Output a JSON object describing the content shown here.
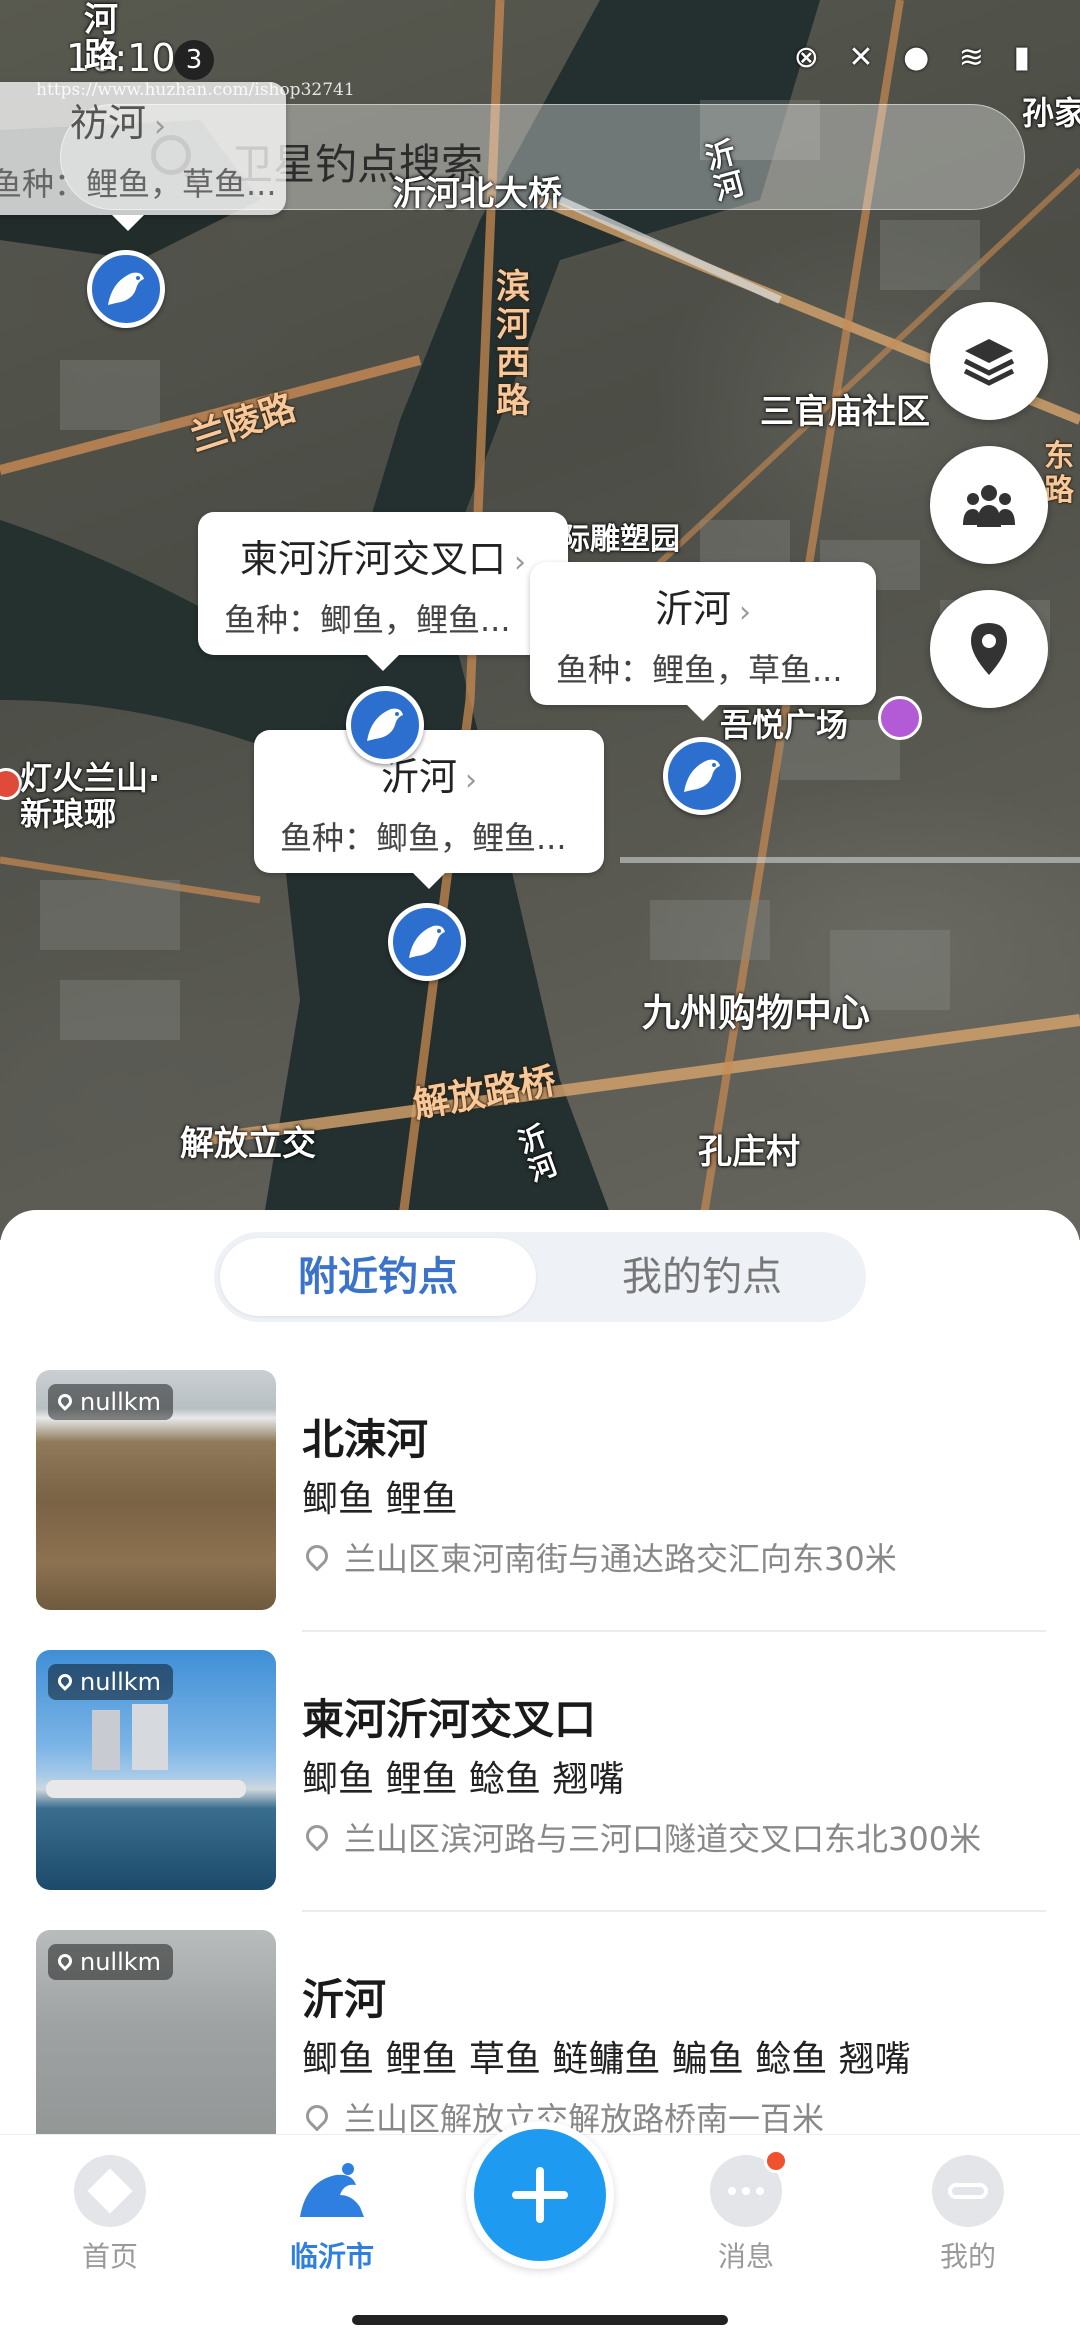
{
  "status": {
    "time": "10:10",
    "badge": "3",
    "icons": "⊗ ✕ ● ≋ ▮",
    "watermark": "https://www.huzhan.com/ishop32741"
  },
  "search": {
    "placeholder": "卫星钓点搜索"
  },
  "map": {
    "labels": {
      "he_lu": "河\n路",
      "yihe_bridge": "沂河北大桥",
      "yi_he_1": "沂\n河",
      "sun_jia": "孙家",
      "binhe_xilu": "滨\n河\n西\n路",
      "lanling_lu": "兰陵路",
      "sanguanmiao": "三官庙社区",
      "diaosu": "际雕塑园",
      "wuyue": "吾悦广场",
      "denghuo": "灯火兰山·\n新琅琊",
      "jiuzhou": "九州购物中心",
      "jiefang_bridge": "解放路桥",
      "jiefang_lijiao": "解放立交",
      "kongzhuang": "孔庄村",
      "yi_he_2": "沂\n河",
      "east_road": "东\n路"
    },
    "callouts": [
      {
        "title": "祊河",
        "sub": "鱼种：鲤鱼，草鱼..."
      },
      {
        "title": "柬河沂河交叉口",
        "sub": "鱼种：鲫鱼，鲤鱼..."
      },
      {
        "title": "沂河",
        "sub": "鱼种：鲤鱼，草鱼..."
      },
      {
        "title": "沂河",
        "sub": "鱼种：鲫鱼，鲤鱼..."
      }
    ],
    "callout_chevron": "›",
    "controls": [
      "layers-icon",
      "group-icon",
      "location-icon"
    ]
  },
  "sheet": {
    "tabs": {
      "nearby": "附近钓点",
      "mine": "我的钓点",
      "active": "nearby"
    },
    "spots": [
      {
        "distance": "nullkm",
        "name": "北涑河",
        "fish": "鲫鱼 鲤鱼",
        "address": "兰山区柬河南街与通达路交汇向东30米"
      },
      {
        "distance": "nullkm",
        "name": "柬河沂河交叉口",
        "fish": "鲫鱼 鲤鱼 鲶鱼 翘嘴",
        "address": "兰山区滨河路与三河口隧道交叉口东北300米"
      },
      {
        "distance": "nullkm",
        "name": "沂河",
        "fish": "鲫鱼 鲤鱼 草鱼 鲢鳙鱼 鳊鱼 鲶鱼 翘嘴",
        "address": "兰山区解放立交解放路桥南一百米"
      }
    ]
  },
  "tabbar": {
    "home": "首页",
    "city": "临沂市",
    "messages": "消息",
    "profile": "我的",
    "active": "city",
    "brand_color": "#2f7fe0",
    "fab_color": "#1e9bf0"
  }
}
